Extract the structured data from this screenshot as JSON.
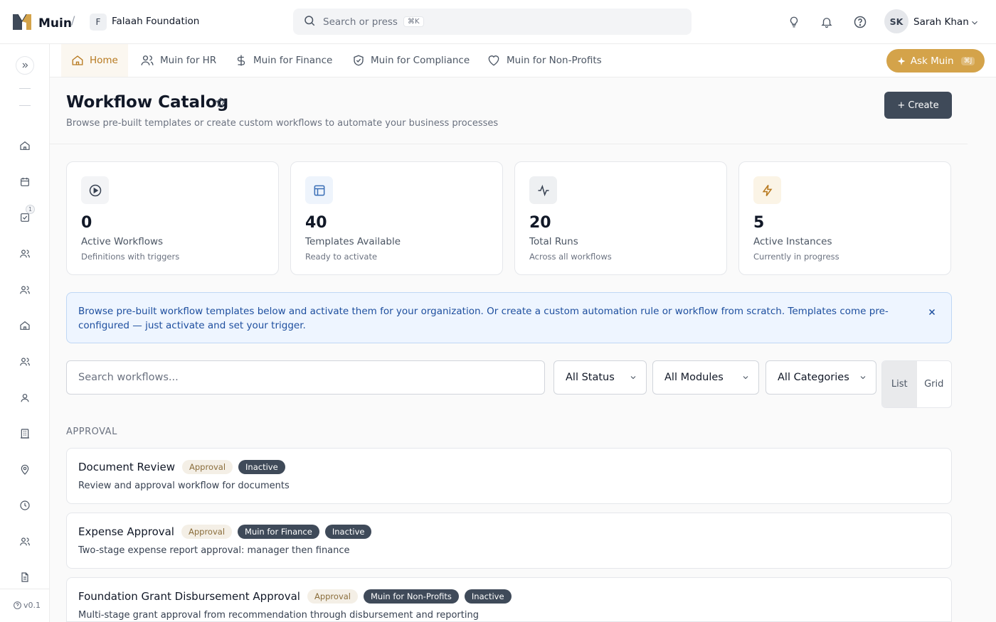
{
  "brand": {
    "name": "Muin",
    "separator": "/"
  },
  "org": {
    "initial": "F",
    "name": "Falaah Foundation"
  },
  "search": {
    "placeholder": "Search or press",
    "shortcut": "⌘K"
  },
  "user": {
    "initials": "SK",
    "name": "Sarah Khan"
  },
  "modules": [
    {
      "label": "Home",
      "icon": "home-icon"
    },
    {
      "label": "Muin for HR",
      "icon": "users-icon"
    },
    {
      "label": "Muin for Finance",
      "icon": "dollar-icon"
    },
    {
      "label": "Muin for Compliance",
      "icon": "shield-check-icon"
    },
    {
      "label": "Muin for Non-Profits",
      "icon": "heart-icon"
    }
  ],
  "ask": {
    "label": "Ask Muin",
    "shortcut": "⌘J"
  },
  "sidebar": {
    "badge": "1",
    "version": "v0.1",
    "icons": [
      "home-icon",
      "calendar-icon",
      "task-check-icon",
      "users-icon",
      "users-icon",
      "building-icon",
      "users-icon",
      "user-icon",
      "office-icon",
      "location-pin-icon",
      "clock-icon",
      "users-icon",
      "document-icon"
    ]
  },
  "header": {
    "title": "Workflow Catalog",
    "subtitle": "Browse pre-built templates or create custom workflows to automate your business processes",
    "create_label": "+ Create"
  },
  "stats": [
    {
      "value": "0",
      "label": "Active Workflows",
      "desc": "Definitions with triggers",
      "icon": "play-circle-icon",
      "bg": "#f3f4f6",
      "color": "#374151"
    },
    {
      "value": "40",
      "label": "Templates Available",
      "desc": "Ready to activate",
      "icon": "layout-template-icon",
      "bg": "#eef4fc",
      "color": "#3b6fb6"
    },
    {
      "value": "20",
      "label": "Total Runs",
      "desc": "Across all workflows",
      "icon": "activity-icon",
      "bg": "#eef0f2",
      "color": "#374151"
    },
    {
      "value": "5",
      "label": "Active Instances",
      "desc": "Currently in progress",
      "icon": "lightning-icon",
      "bg": "#fbf4e6",
      "color": "#b7791f"
    }
  ],
  "banner": {
    "text": "Browse pre-built workflow templates below and activate them for your organization. Or create a custom automation rule or workflow from scratch. Templates come pre-configured — just activate and set your trigger."
  },
  "filters": {
    "search_placeholder": "Search workflows...",
    "status": "All Status",
    "modules": "All Modules",
    "categories": "All Categories",
    "view_list": "List",
    "view_grid": "Grid"
  },
  "section": {
    "label": "APPROVAL"
  },
  "workflows": [
    {
      "title": "Document Review",
      "category": "Approval",
      "module": "",
      "status": "Inactive",
      "desc": "Review and approval workflow for documents"
    },
    {
      "title": "Expense Approval",
      "category": "Approval",
      "module": "Muin for Finance",
      "status": "Inactive",
      "desc": "Two-stage expense report approval: manager then finance"
    },
    {
      "title": "Foundation Grant Disbursement Approval",
      "category": "Approval",
      "module": "Muin for Non-Profits",
      "status": "Inactive",
      "desc": "Multi-stage grant approval from recommendation through disbursement and reporting"
    }
  ],
  "colors": {
    "accent": "#d4a34a",
    "primary_dark": "#3f4a59",
    "banner_text": "#1d4e9e"
  }
}
